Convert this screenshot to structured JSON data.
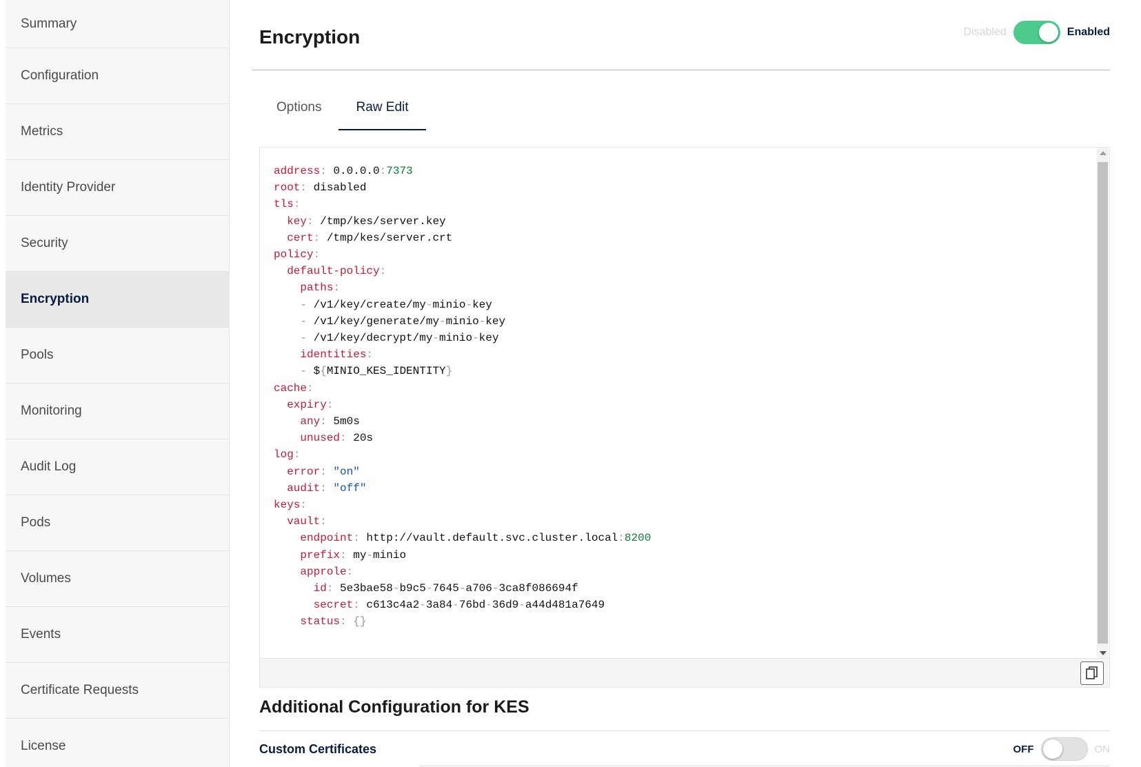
{
  "sidebar": {
    "items": [
      {
        "label": "Summary"
      },
      {
        "label": "Configuration"
      },
      {
        "label": "Metrics"
      },
      {
        "label": "Identity Provider"
      },
      {
        "label": "Security"
      },
      {
        "label": "Encryption",
        "active": true
      },
      {
        "label": "Pools"
      },
      {
        "label": "Monitoring"
      },
      {
        "label": "Audit Log"
      },
      {
        "label": "Pods"
      },
      {
        "label": "Volumes"
      },
      {
        "label": "Events"
      },
      {
        "label": "Certificate Requests"
      },
      {
        "label": "License"
      }
    ]
  },
  "header": {
    "title": "Encryption",
    "toggle": {
      "off_label": "Disabled",
      "on_label": "Enabled",
      "state": "on"
    }
  },
  "tabs": [
    {
      "label": "Options",
      "active": false
    },
    {
      "label": "Raw Edit",
      "active": true
    }
  ],
  "editor": {
    "lines": [
      [
        [
          "k",
          "address"
        ],
        [
          "p",
          ": "
        ],
        [
          "t",
          "0.0.0.0"
        ],
        [
          "p",
          ":"
        ],
        [
          "n",
          "7373"
        ]
      ],
      [
        [
          "k",
          "root"
        ],
        [
          "p",
          ": "
        ],
        [
          "t",
          "disabled"
        ]
      ],
      [
        [
          "k",
          "tls"
        ],
        [
          "p",
          ":"
        ]
      ],
      [
        [
          "t",
          "  "
        ],
        [
          "k",
          "key"
        ],
        [
          "p",
          ": "
        ],
        [
          "t",
          "/tmp/kes/server.key"
        ]
      ],
      [
        [
          "t",
          "  "
        ],
        [
          "k",
          "cert"
        ],
        [
          "p",
          ": "
        ],
        [
          "t",
          "/tmp/kes/server.crt"
        ]
      ],
      [
        [
          "k",
          "policy"
        ],
        [
          "p",
          ":"
        ]
      ],
      [
        [
          "t",
          "  "
        ],
        [
          "k",
          "default-policy"
        ],
        [
          "p",
          ":"
        ]
      ],
      [
        [
          "t",
          "    "
        ],
        [
          "k",
          "paths"
        ],
        [
          "p",
          ":"
        ]
      ],
      [
        [
          "t",
          "    "
        ],
        [
          "p",
          "- "
        ],
        [
          "t",
          "/v1/key/create/my"
        ],
        [
          "p",
          "-"
        ],
        [
          "t",
          "minio"
        ],
        [
          "p",
          "-"
        ],
        [
          "t",
          "key"
        ]
      ],
      [
        [
          "t",
          "    "
        ],
        [
          "p",
          "- "
        ],
        [
          "t",
          "/v1/key/generate/my"
        ],
        [
          "p",
          "-"
        ],
        [
          "t",
          "minio"
        ],
        [
          "p",
          "-"
        ],
        [
          "t",
          "key"
        ]
      ],
      [
        [
          "t",
          "    "
        ],
        [
          "p",
          "- "
        ],
        [
          "t",
          "/v1/key/decrypt/my"
        ],
        [
          "p",
          "-"
        ],
        [
          "t",
          "minio"
        ],
        [
          "p",
          "-"
        ],
        [
          "t",
          "key"
        ]
      ],
      [
        [
          "t",
          "    "
        ],
        [
          "k",
          "identities"
        ],
        [
          "p",
          ":"
        ]
      ],
      [
        [
          "t",
          "    "
        ],
        [
          "p",
          "- "
        ],
        [
          "t",
          "$"
        ],
        [
          "p",
          "{"
        ],
        [
          "t",
          "MINIO_KES_IDENTITY"
        ],
        [
          "p",
          "}"
        ]
      ],
      [
        [
          "k",
          "cache"
        ],
        [
          "p",
          ":"
        ]
      ],
      [
        [
          "t",
          "  "
        ],
        [
          "k",
          "expiry"
        ],
        [
          "p",
          ":"
        ]
      ],
      [
        [
          "t",
          "    "
        ],
        [
          "k",
          "any"
        ],
        [
          "p",
          ": "
        ],
        [
          "t",
          "5m0s"
        ]
      ],
      [
        [
          "t",
          "    "
        ],
        [
          "k",
          "unused"
        ],
        [
          "p",
          ": "
        ],
        [
          "t",
          "20s"
        ]
      ],
      [
        [
          "k",
          "log"
        ],
        [
          "p",
          ":"
        ]
      ],
      [
        [
          "t",
          "  "
        ],
        [
          "k",
          "error"
        ],
        [
          "p",
          ": "
        ],
        [
          "s",
          "\"on\""
        ]
      ],
      [
        [
          "t",
          "  "
        ],
        [
          "k",
          "audit"
        ],
        [
          "p",
          ": "
        ],
        [
          "s",
          "\"off\""
        ]
      ],
      [
        [
          "k",
          "keys"
        ],
        [
          "p",
          ":"
        ]
      ],
      [
        [
          "t",
          "  "
        ],
        [
          "k",
          "vault"
        ],
        [
          "p",
          ":"
        ]
      ],
      [
        [
          "t",
          "    "
        ],
        [
          "k",
          "endpoint"
        ],
        [
          "p",
          ": "
        ],
        [
          "t",
          "http://vault.default.svc.cluster.local"
        ],
        [
          "p",
          ":"
        ],
        [
          "n",
          "8200"
        ]
      ],
      [
        [
          "t",
          "    "
        ],
        [
          "k",
          "prefix"
        ],
        [
          "p",
          ": "
        ],
        [
          "t",
          "my"
        ],
        [
          "p",
          "-"
        ],
        [
          "t",
          "minio"
        ]
      ],
      [
        [
          "t",
          "    "
        ],
        [
          "k",
          "approle"
        ],
        [
          "p",
          ":"
        ]
      ],
      [
        [
          "t",
          "      "
        ],
        [
          "k",
          "id"
        ],
        [
          "p",
          ": "
        ],
        [
          "t",
          "5e3bae58"
        ],
        [
          "p",
          "-"
        ],
        [
          "t",
          "b9c5"
        ],
        [
          "p",
          "-"
        ],
        [
          "t",
          "7645"
        ],
        [
          "p",
          "-"
        ],
        [
          "t",
          "a706"
        ],
        [
          "p",
          "-"
        ],
        [
          "t",
          "3ca8f086694f"
        ]
      ],
      [
        [
          "t",
          "      "
        ],
        [
          "k",
          "secret"
        ],
        [
          "p",
          ": "
        ],
        [
          "t",
          "c613c4a2"
        ],
        [
          "p",
          "-"
        ],
        [
          "t",
          "3a84"
        ],
        [
          "p",
          "-"
        ],
        [
          "t",
          "76bd"
        ],
        [
          "p",
          "-"
        ],
        [
          "t",
          "36d9"
        ],
        [
          "p",
          "-"
        ],
        [
          "t",
          "a44d481a7649"
        ]
      ],
      [
        [
          "t",
          "    "
        ],
        [
          "k",
          "status"
        ],
        [
          "p",
          ": "
        ],
        [
          "p",
          "{}"
        ]
      ]
    ],
    "copy_icon": "copy-icon"
  },
  "additional": {
    "title": "Additional Configuration for KES",
    "custom_certs": {
      "label": "Custom Certificates",
      "off_label": "OFF",
      "on_label": "ON",
      "state": "off"
    }
  },
  "colors": {
    "accent": "#4ccb8d",
    "navy": "#081c42",
    "yaml_key": "#c41a35",
    "yaml_number": "#0e7a34",
    "yaml_string": "#1453b6"
  }
}
